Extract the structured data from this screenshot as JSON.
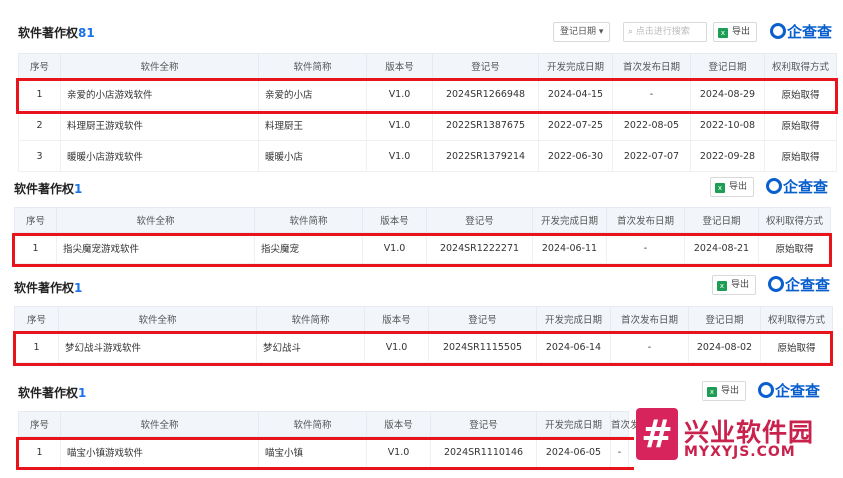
{
  "columns": [
    "序号",
    "软件全称",
    "软件简称",
    "版本号",
    "登记号",
    "开发完成日期",
    "首次发布日期",
    "登记日期",
    "权利取得方式"
  ],
  "panels": [
    {
      "title": "软件著作权",
      "count": "81",
      "date_filter": "登记日期 ▾",
      "search_placeholder": "点击进行搜索",
      "export_label": "导出",
      "logo": "企查查",
      "rows": [
        [
          "1",
          "亲爱的小店游戏软件",
          "亲爱的小店",
          "V1.0",
          "2024SR1266948",
          "2024-04-15",
          "-",
          "2024-08-29",
          "原始取得"
        ],
        [
          "2",
          "料理厨王游戏软件",
          "料理厨王",
          "V1.0",
          "2022SR1387675",
          "2022-07-25",
          "2022-08-05",
          "2022-10-08",
          "原始取得"
        ],
        [
          "3",
          "暖暖小店游戏软件",
          "暖暖小店",
          "V1.0",
          "2022SR1379214",
          "2022-06-30",
          "2022-07-07",
          "2022-09-28",
          "原始取得"
        ]
      ]
    },
    {
      "title": "软件著作权",
      "count": "1",
      "export_label": "导出",
      "logo": "企查查",
      "rows": [
        [
          "1",
          "指尖魔宠游戏软件",
          "指尖魔宠",
          "V1.0",
          "2024SR1222271",
          "2024-06-11",
          "-",
          "2024-08-21",
          "原始取得"
        ]
      ]
    },
    {
      "title": "软件著作权",
      "count": "1",
      "export_label": "导出",
      "logo": "企查查",
      "rows": [
        [
          "1",
          "梦幻战斗游戏软件",
          "梦幻战斗",
          "V1.0",
          "2024SR1115505",
          "2024-06-14",
          "-",
          "2024-08-02",
          "原始取得"
        ]
      ]
    },
    {
      "title": "软件著作权",
      "count": "1",
      "export_label": "导出",
      "logo": "企查查",
      "rows": [
        [
          "1",
          "喵宝小镇游戏软件",
          "喵宝小镇",
          "V1.0",
          "2024SR1110146",
          "2024-06-05",
          "-"
        ]
      ]
    }
  ],
  "watermark": {
    "mark": "#",
    "title": "兴业软件园",
    "subtitle": "MYXYJS.COM"
  },
  "colors": {
    "highlight": "#e8141c",
    "count": "#1a73e8",
    "brand": "#0a5fcf",
    "watermark": "#c8224d"
  }
}
